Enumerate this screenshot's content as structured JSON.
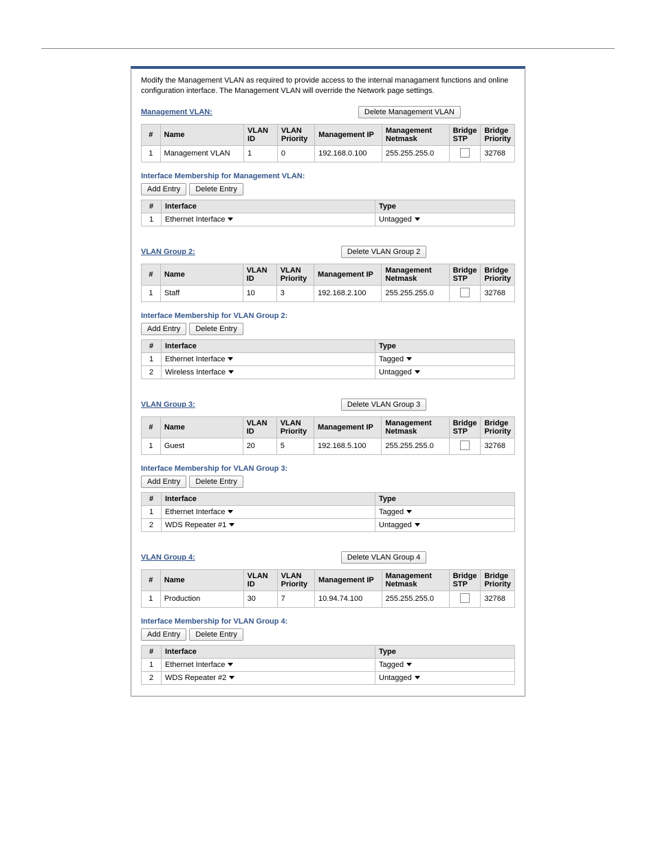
{
  "intro": "Modify the Management VLAN as required to provide access to the internal managament functions and online configuration interface. The Management VLAN will override the Network page settings.",
  "headers": {
    "num": "#",
    "name": "Name",
    "vlan_id": "VLAN ID",
    "vlan_priority": "VLAN Priority",
    "mgmt_ip": "Management IP",
    "mgmt_netmask": "Management Netmask",
    "bridge_stp": "Bridge STP",
    "bridge_priority": "Bridge Priority",
    "interface": "Interface",
    "type": "Type"
  },
  "buttons": {
    "add_entry": "Add Entry",
    "delete_entry": "Delete Entry"
  },
  "groups": [
    {
      "title": "Management VLAN:",
      "delete_label": "Delete Management VLAN",
      "membership_title": "Interface Membership for Management VLAN:",
      "row": {
        "num": "1",
        "name": "Management VLAN",
        "vlan_id": "1",
        "vlan_priority": "0",
        "mgmt_ip": "192.168.0.100",
        "mgmt_netmask": "255.255.255.0",
        "bridge_priority": "32768"
      },
      "interfaces": [
        {
          "num": "1",
          "name": "Ethernet Interface",
          "type": "Untagged"
        }
      ]
    },
    {
      "title": "VLAN Group 2:",
      "delete_label": "Delete VLAN Group 2",
      "membership_title": "Interface Membership for VLAN Group 2:",
      "row": {
        "num": "1",
        "name": "Staff",
        "vlan_id": "10",
        "vlan_priority": "3",
        "mgmt_ip": "192.168.2.100",
        "mgmt_netmask": "255.255.255.0",
        "bridge_priority": "32768"
      },
      "interfaces": [
        {
          "num": "1",
          "name": "Ethernet Interface",
          "type": "Tagged"
        },
        {
          "num": "2",
          "name": "Wireless Interface",
          "type": "Untagged"
        }
      ]
    },
    {
      "title": "VLAN Group 3:",
      "delete_label": "Delete VLAN Group 3",
      "membership_title": "Interface Membership for VLAN Group 3:",
      "row": {
        "num": "1",
        "name": "Guest",
        "vlan_id": "20",
        "vlan_priority": "5",
        "mgmt_ip": "192.168.5.100",
        "mgmt_netmask": "255.255.255.0",
        "bridge_priority": "32768"
      },
      "interfaces": [
        {
          "num": "1",
          "name": "Ethernet Interface",
          "type": "Tagged"
        },
        {
          "num": "2",
          "name": "WDS Repeater #1",
          "type": "Untagged"
        }
      ]
    },
    {
      "title": "VLAN Group 4:",
      "delete_label": "Delete VLAN Group 4",
      "membership_title": "Interface Membership for VLAN Group 4:",
      "row": {
        "num": "1",
        "name": "Production",
        "vlan_id": "30",
        "vlan_priority": "7",
        "mgmt_ip": "10.94.74.100",
        "mgmt_netmask": "255.255.255.0",
        "bridge_priority": "32768"
      },
      "interfaces": [
        {
          "num": "1",
          "name": "Ethernet Interface",
          "type": "Tagged"
        },
        {
          "num": "2",
          "name": "WDS Repeater #2",
          "type": "Untagged"
        }
      ]
    }
  ]
}
